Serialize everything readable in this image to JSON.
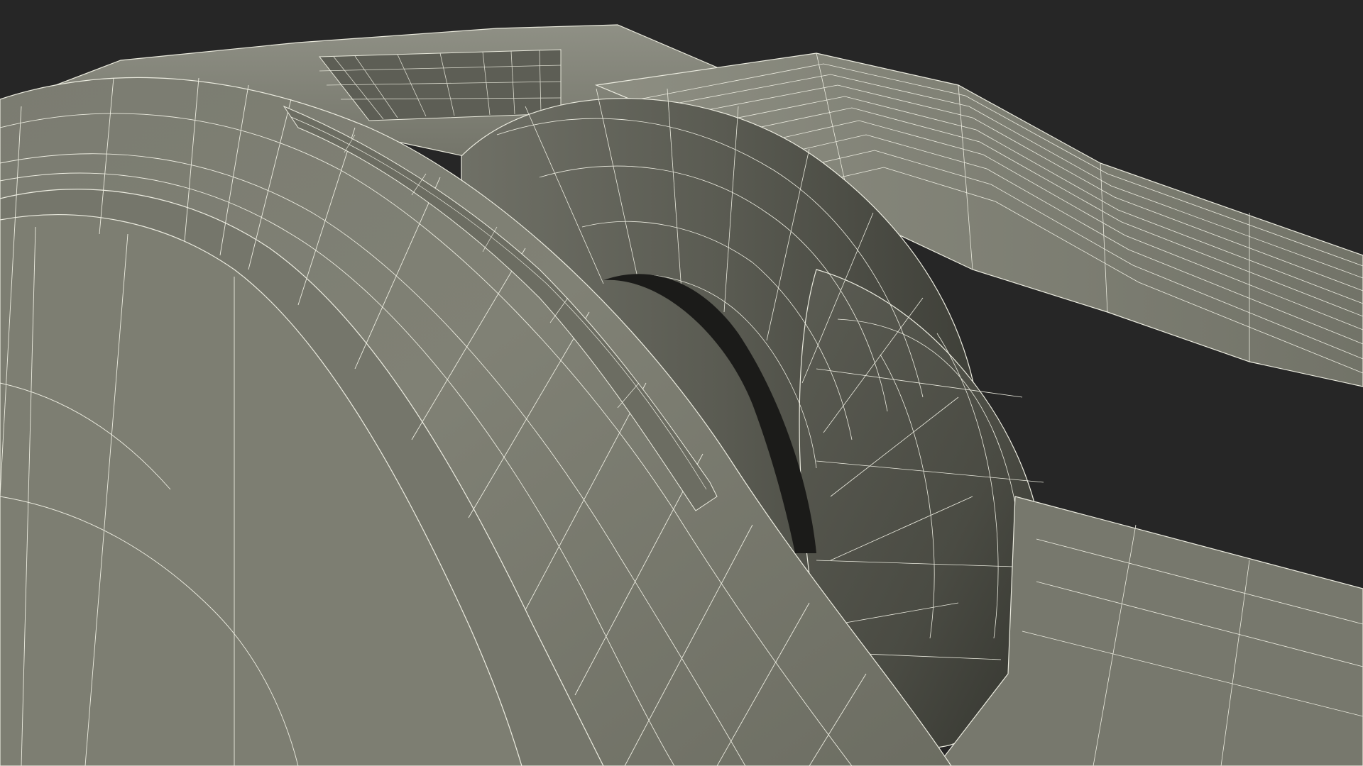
{
  "scene": {
    "subject": "3d-wireframe-render",
    "colors": {
      "background": "#262626",
      "surface_light": "#8a8b80",
      "surface_mid": "#737469",
      "surface_dark": "#3f4039",
      "shadow": "#1b1b19",
      "wire": "#f2f2e6"
    }
  }
}
